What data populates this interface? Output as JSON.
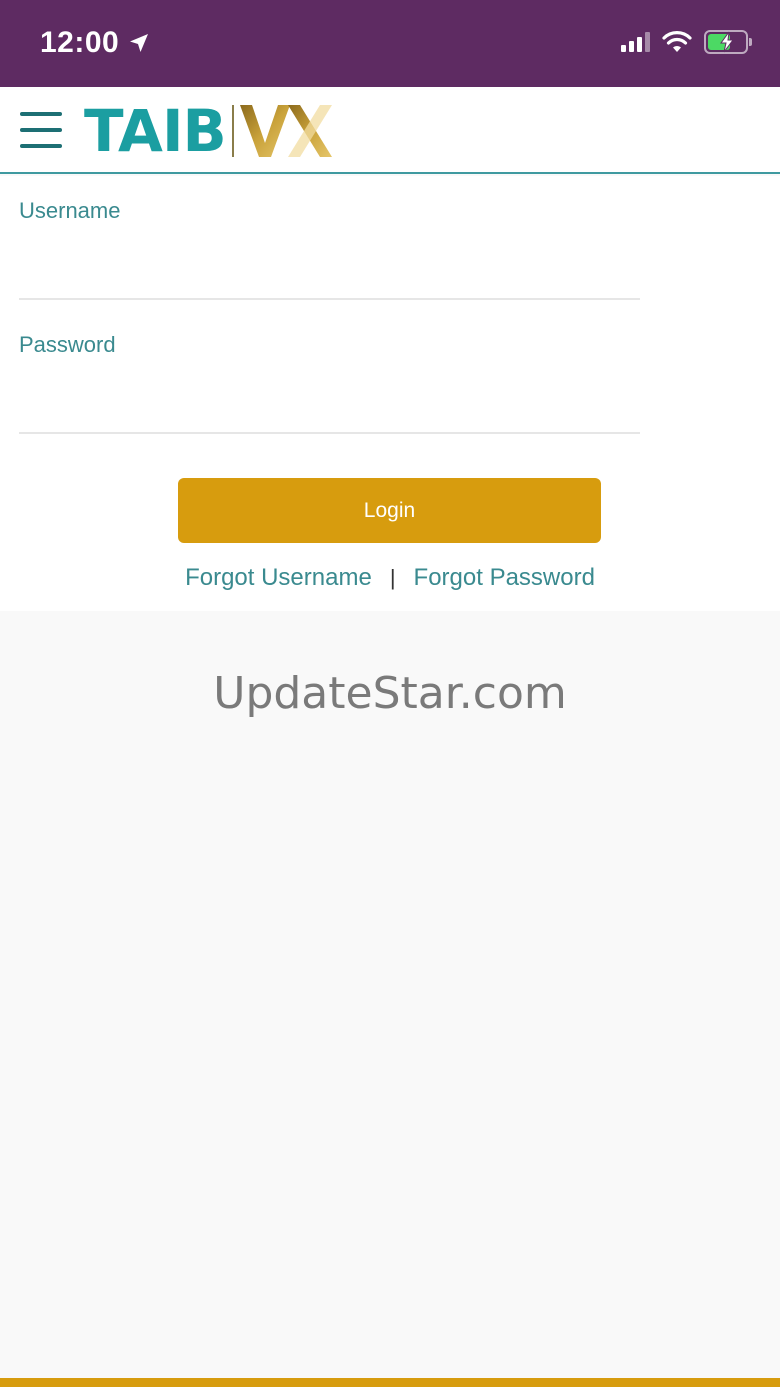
{
  "status_bar": {
    "time": "12:00",
    "icons": [
      "location-arrow-icon",
      "cellular-signal-icon",
      "wifi-icon",
      "battery-charging-icon"
    ],
    "background_color": "#5e2b62"
  },
  "header": {
    "menu_icon": "hamburger-menu-icon",
    "logo_text": "TAIB",
    "logo_mark_text": "VX",
    "accent_color": "#1b9ea1"
  },
  "login": {
    "username_label": "Username",
    "username_value": "",
    "password_label": "Password",
    "password_value": "",
    "login_button": "Login",
    "forgot_username": "Forgot Username",
    "separator": "|",
    "forgot_password": "Forgot Password",
    "button_color": "#d79c0e"
  },
  "watermark": "UpdateStar.com"
}
